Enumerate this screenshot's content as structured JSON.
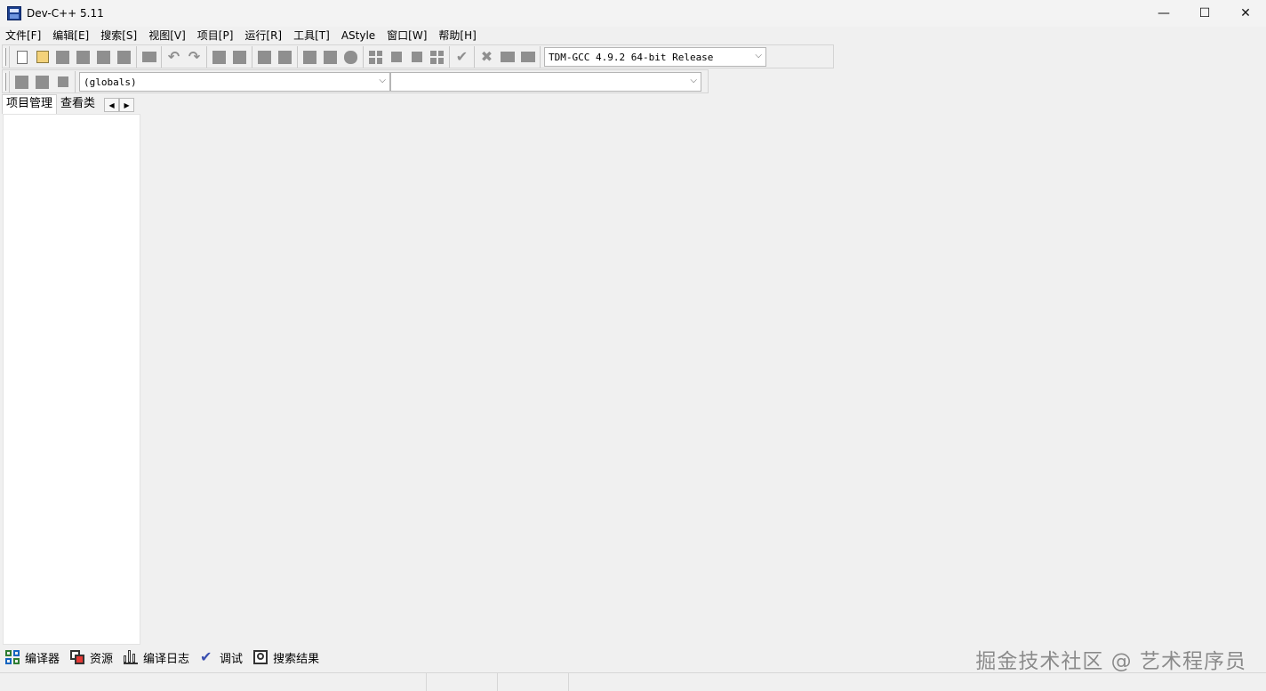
{
  "window": {
    "title": "Dev-C++ 5.11",
    "controls": {
      "minimize": "—",
      "maximize": "☐",
      "close": "✕"
    }
  },
  "menu": [
    "文件[F]",
    "编辑[E]",
    "搜索[S]",
    "视图[V]",
    "项目[P]",
    "运行[R]",
    "工具[T]",
    "AStyle",
    "窗口[W]",
    "帮助[H]"
  ],
  "toolbar": {
    "compiler_select": {
      "value": "TDM-GCC 4.9.2 64-bit Release",
      "chevron": "⌵"
    }
  },
  "toolbar2": {
    "scope_select": {
      "value": "(globals)",
      "chevron": "⌵"
    },
    "member_select": {
      "value": "",
      "chevron": "⌵"
    }
  },
  "left_panel": {
    "tabs": [
      "项目管理",
      "查看类"
    ],
    "active_tab": "项目管理",
    "scroll_left": "◀",
    "scroll_right": "▶"
  },
  "bottom_tabs": [
    "编译器",
    "资源",
    "编译日志",
    "调试",
    "搜索结果"
  ],
  "watermark": "掘金技术社区 @ 艺术程序员",
  "statusbar": {
    "cells": [
      "",
      "",
      "",
      ""
    ]
  }
}
